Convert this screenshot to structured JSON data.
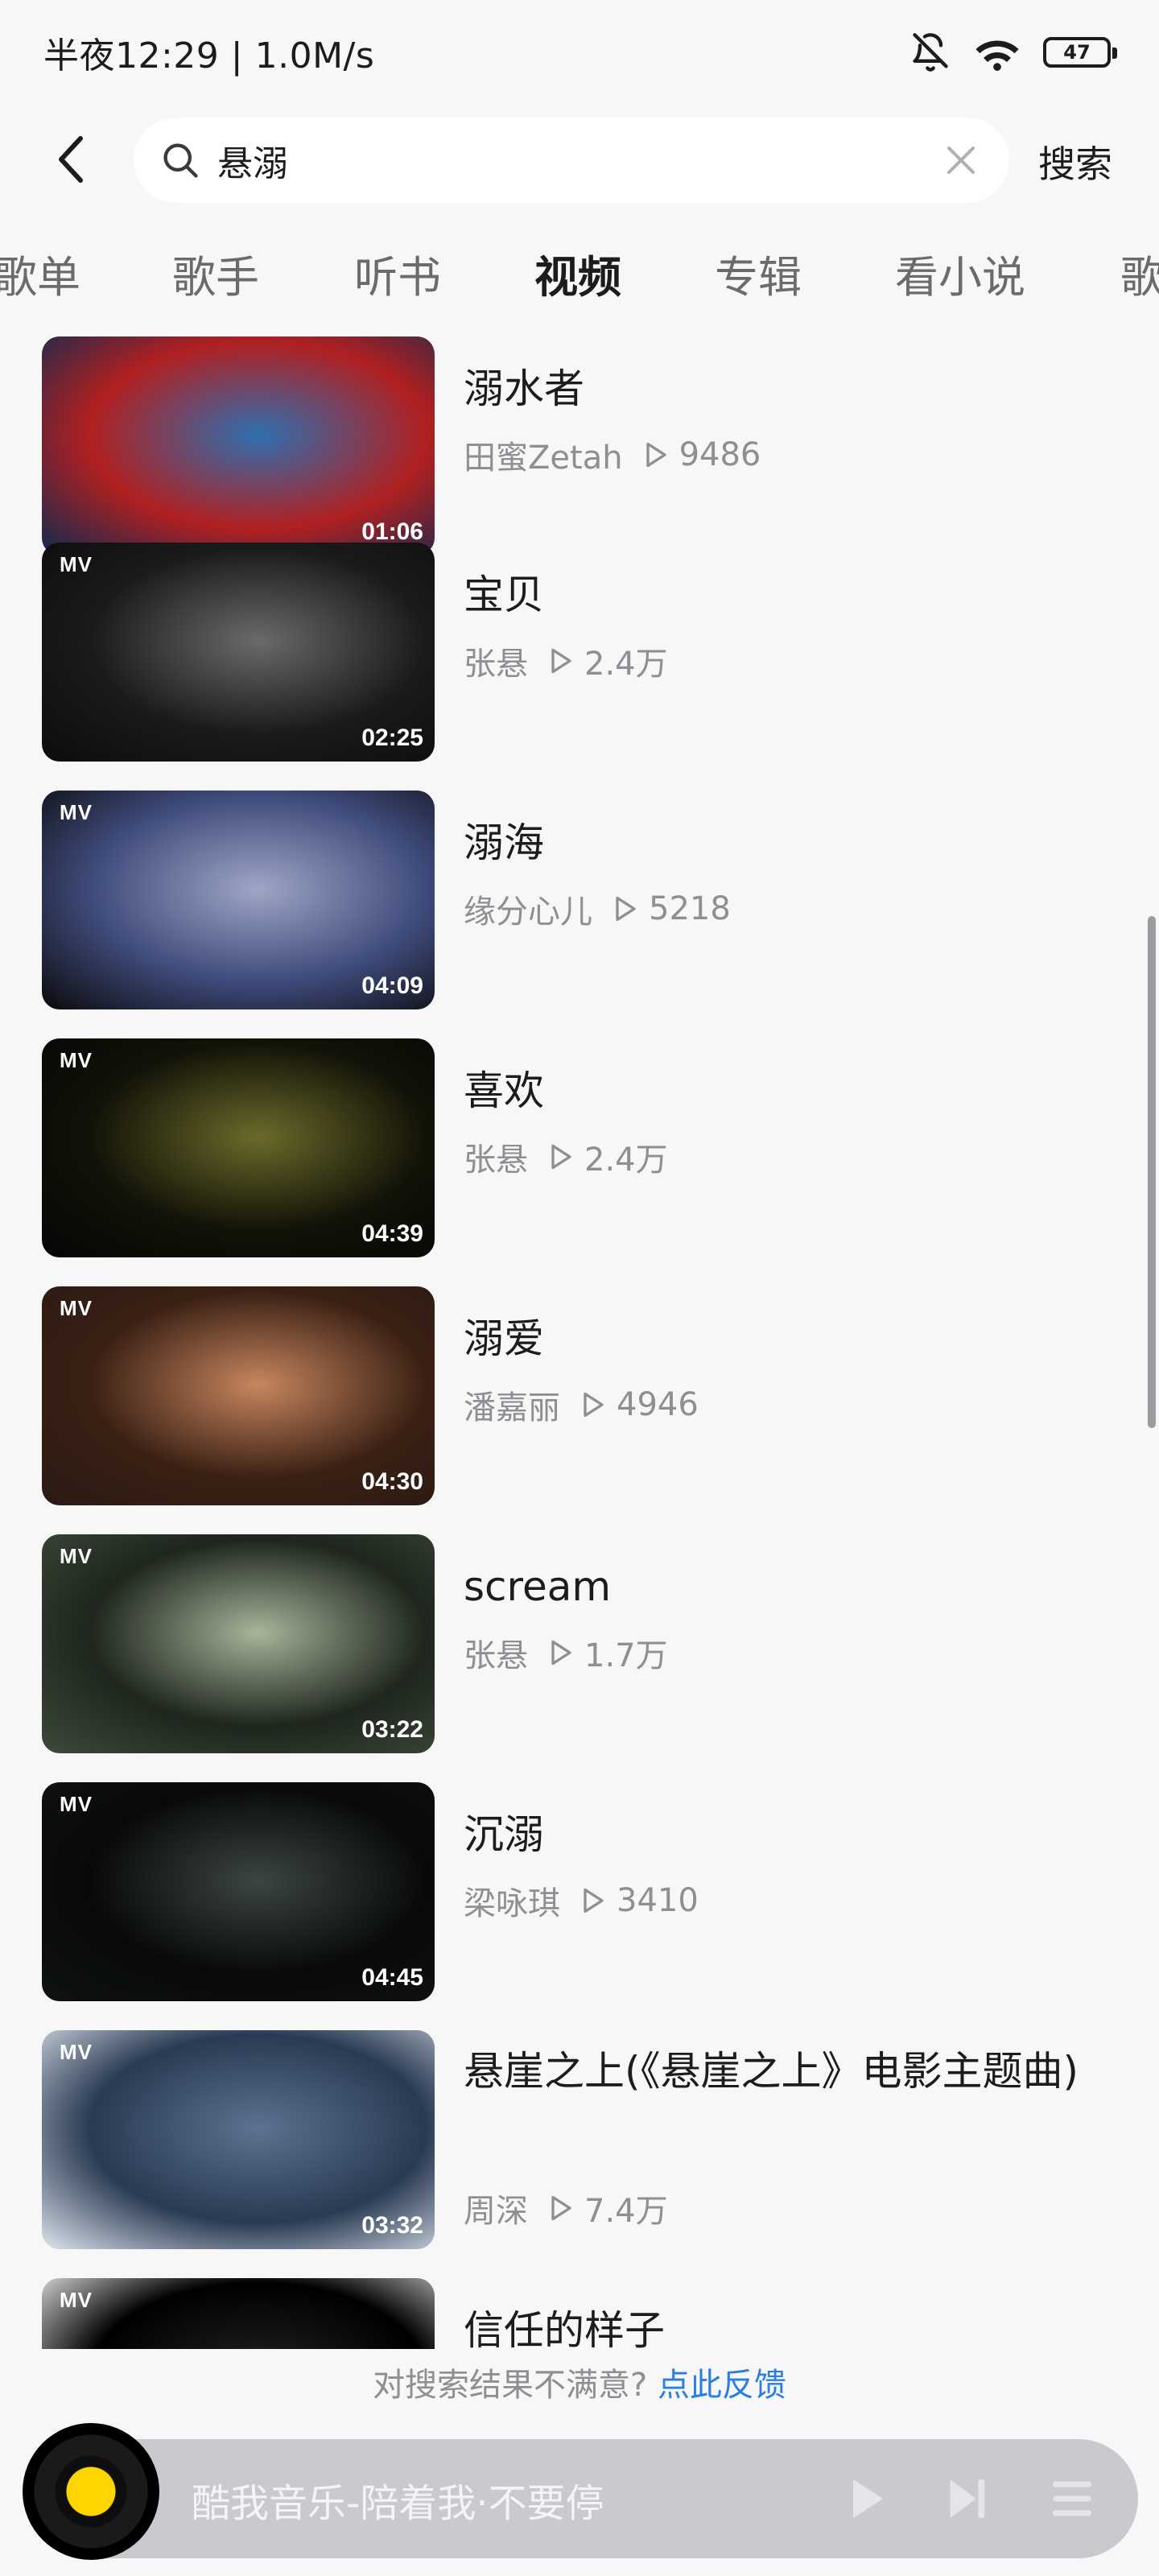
{
  "status_bar": {
    "time_speed": "半夜12:29 | 1.0M/s",
    "battery": "47"
  },
  "search": {
    "query": "悬溺",
    "button_label": "搜索"
  },
  "tabs": [
    {
      "label": "歌单",
      "active": false
    },
    {
      "label": "歌手",
      "active": false
    },
    {
      "label": "听书",
      "active": false
    },
    {
      "label": "视频",
      "active": true
    },
    {
      "label": "专辑",
      "active": false
    },
    {
      "label": "看小说",
      "active": false
    },
    {
      "label": "歌",
      "active": false
    }
  ],
  "videos": [
    {
      "title": "溺水者",
      "artist": "田蜜Zetah",
      "plays": "9486",
      "duration": "01:06",
      "mv": false,
      "thumb_colors": [
        "#0b2a52",
        "#2f6fb0",
        "#b02020"
      ]
    },
    {
      "title": "宝贝",
      "artist": "张悬",
      "plays": "2.4万",
      "duration": "02:25",
      "mv": true,
      "thumb_colors": [
        "#0c0c0c",
        "#6a6a6a",
        "#1a1a1a"
      ]
    },
    {
      "title": "溺海",
      "artist": "缘分心儿",
      "plays": "5218",
      "duration": "04:09",
      "mv": true,
      "thumb_colors": [
        "#0a0a0a",
        "#9ea6c6",
        "#3e4a7a"
      ]
    },
    {
      "title": "喜欢",
      "artist": "张悬",
      "plays": "2.4万",
      "duration": "04:39",
      "mv": true,
      "thumb_colors": [
        "#050505",
        "#6b6a2a",
        "#121208"
      ]
    },
    {
      "title": "溺爱",
      "artist": "潘嘉丽",
      "plays": "4946",
      "duration": "04:30",
      "mv": true,
      "thumb_colors": [
        "#2a1a14",
        "#c7865e",
        "#3a2014"
      ]
    },
    {
      "title": "scream",
      "artist": "张悬",
      "plays": "1.7万",
      "duration": "03:22",
      "mv": true,
      "thumb_colors": [
        "#3d4a3a",
        "#a8b49a",
        "#1e261d"
      ]
    },
    {
      "title": "沉溺",
      "artist": "梁咏琪",
      "plays": "3410",
      "duration": "04:45",
      "mv": true,
      "thumb_colors": [
        "#0e1210",
        "#3c4540",
        "#080a09"
      ]
    },
    {
      "title": "悬崖之上(《悬崖之上》电影主题曲)",
      "artist": "周深",
      "plays": "7.4万",
      "duration": "03:32",
      "mv": true,
      "thumb_colors": [
        "#dfe6ef",
        "#5c7290",
        "#293a52"
      ]
    },
    {
      "title": "信任的样子",
      "artist": "",
      "plays": "",
      "duration": "",
      "mv": true,
      "thumb_colors": [
        "#ffffff",
        "#222222",
        "#000000"
      ]
    }
  ],
  "feedback": {
    "text": "对搜索结果不满意?",
    "link": "点此反馈"
  },
  "player": {
    "title": "酷我音乐-陪着我·不要停"
  },
  "icons": {
    "mute": "bell-slash-icon",
    "wifi": "wifi-icon",
    "back": "chevron-left-icon",
    "search": "search-icon",
    "clear": "close-icon",
    "play": "play-icon",
    "next": "next-icon",
    "playlist": "playlist-icon"
  }
}
